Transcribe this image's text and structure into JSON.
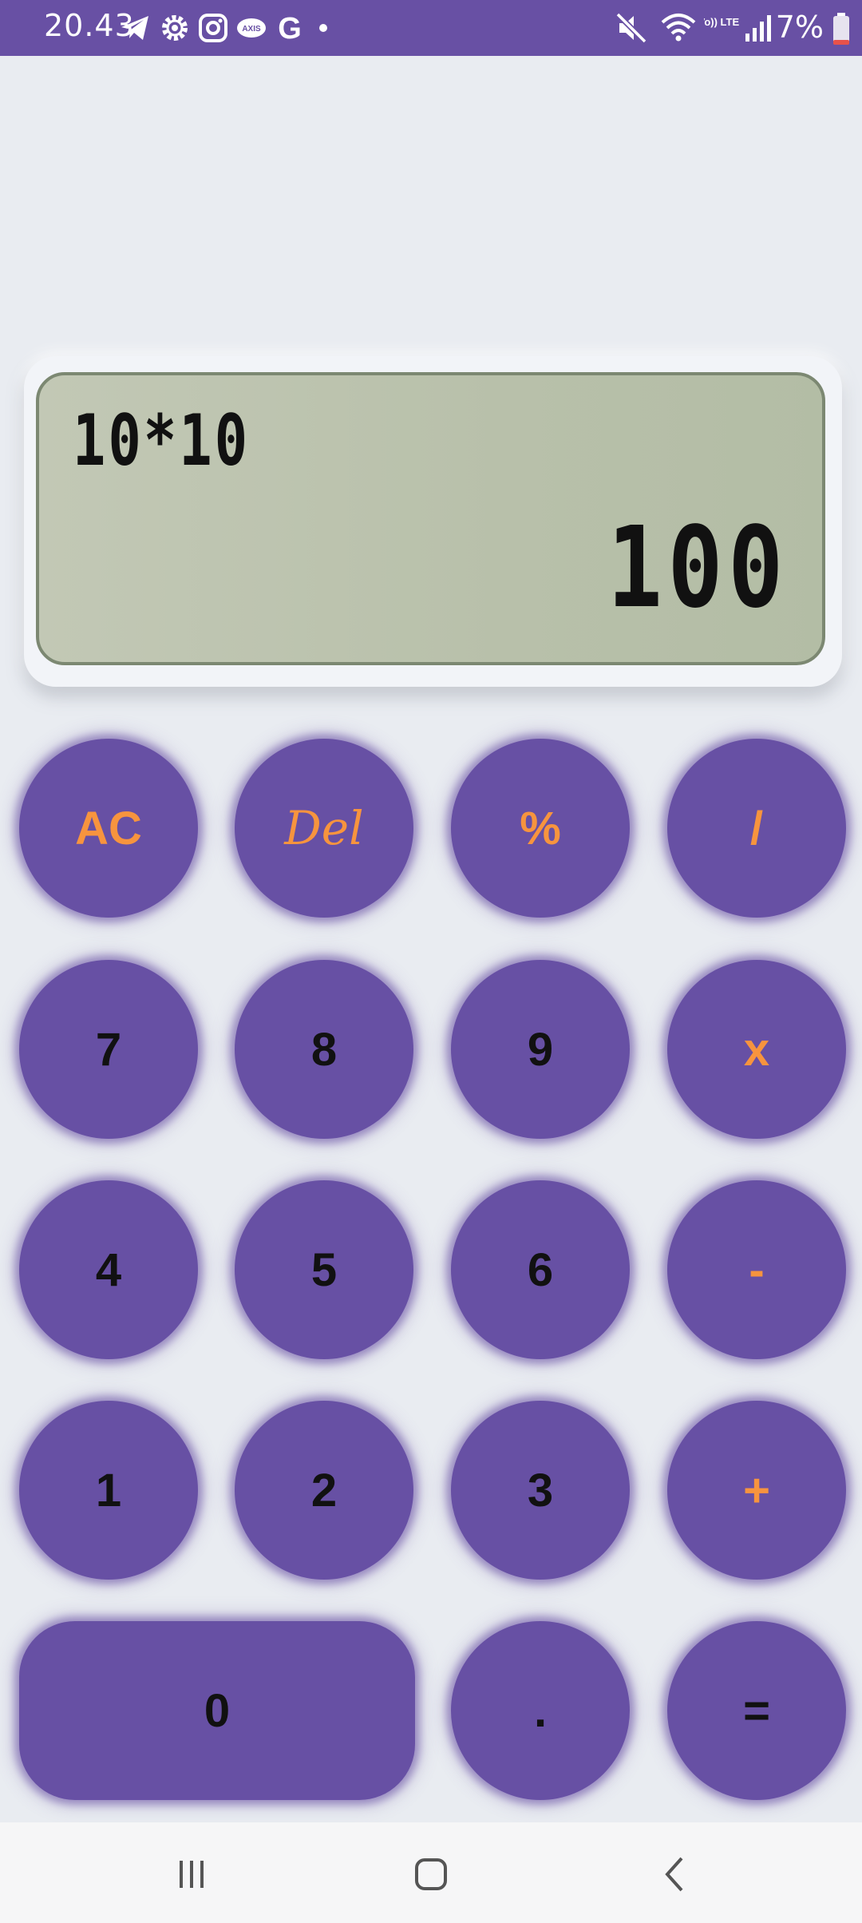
{
  "status_bar": {
    "time": "20.43",
    "battery": "7%",
    "left_icons": [
      "telegram-icon",
      "settings-gear-icon",
      "instagram-icon",
      "axis-icon",
      "google-icon",
      "dot-icon"
    ],
    "right_icons": [
      "mute-icon",
      "wifi-icon",
      "volte-icon",
      "signal-icon",
      "battery-icon"
    ],
    "volte_label": "Vo)) LTE1",
    "axis_label": "AXIS",
    "google_label": "G",
    "colors": {
      "background": "#6850a4"
    }
  },
  "display": {
    "expression": "10*10",
    "result": "100",
    "colors": {
      "lcd": "#b8c0aa",
      "lcd_border": "#7c8872"
    }
  },
  "keypad": {
    "rows": [
      [
        "AC",
        "Del",
        "%",
        "/"
      ],
      [
        "7",
        "8",
        "9",
        "x"
      ],
      [
        "4",
        "5",
        "6",
        "-"
      ],
      [
        "1",
        "2",
        "3",
        "+"
      ],
      [
        "0",
        ".",
        "="
      ]
    ],
    "colors": {
      "key": "#6750a4",
      "operator_text": "#f7943e",
      "digit_text": "#111111"
    }
  },
  "nav_bar": {
    "icons": [
      "recent-apps-icon",
      "home-icon",
      "back-icon"
    ]
  }
}
